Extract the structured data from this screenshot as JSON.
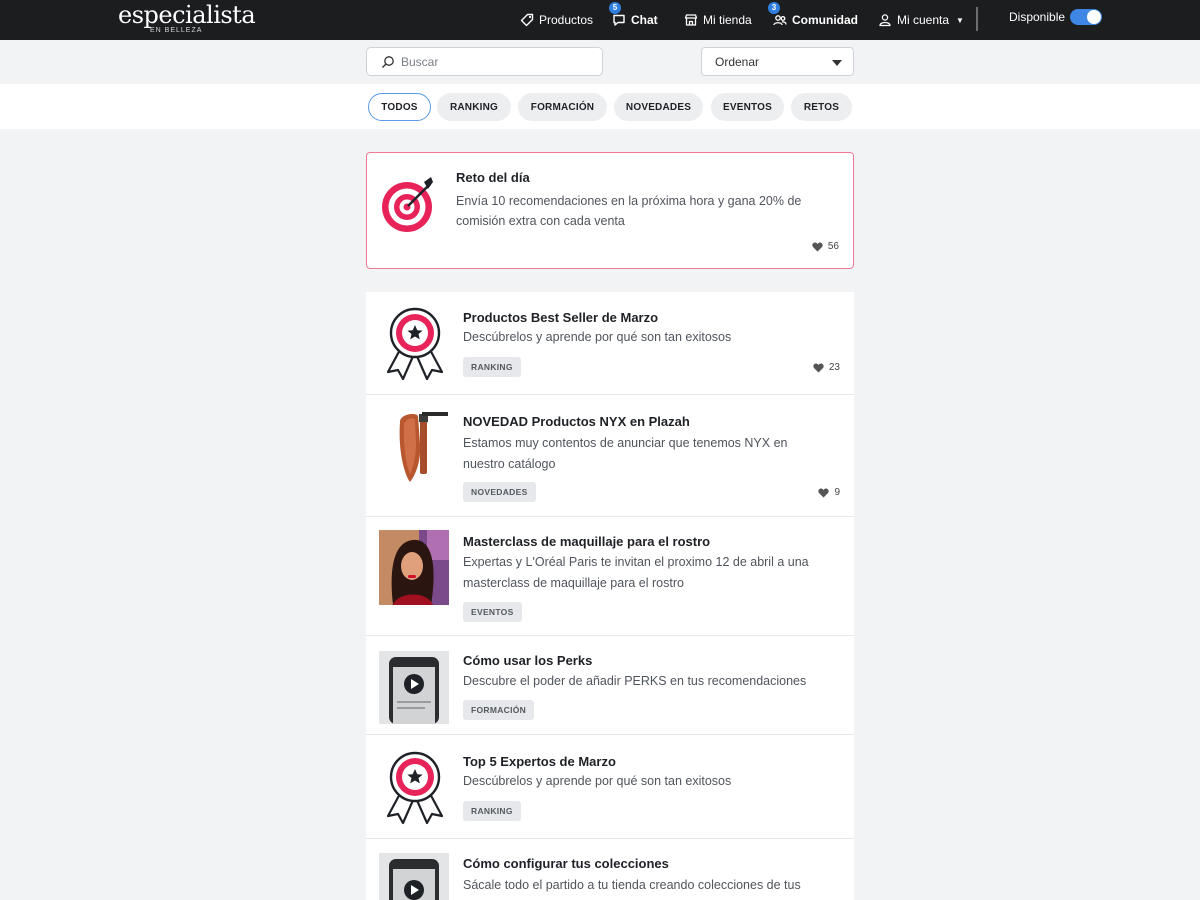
{
  "brand": {
    "name": "especialista",
    "sub": "EN BELLEZA"
  },
  "nav": {
    "productos": "Productos",
    "chat": "Chat",
    "chat_badge": "5",
    "tienda": "Mi tienda",
    "comunidad": "Comunidad",
    "comunidad_badge": "3",
    "cuenta": "Mi cuenta",
    "disponible": "Disponible",
    "disponible_on": true
  },
  "search": {
    "placeholder": "Buscar",
    "icon": "search-icon"
  },
  "order": {
    "label": "Ordenar"
  },
  "filters": [
    "TODOS",
    "RANKING",
    "FORMACIÓN",
    "NOVEDADES",
    "EVENTOS",
    "RETOS"
  ],
  "challenge": {
    "title": "Reto del día",
    "desc_line1": "Envía 10 recomendaciones en la próxima hora y gana 20% de",
    "desc_line2": "comisión extra con cada venta",
    "likes": "56",
    "icon": "target-icon"
  },
  "feed": [
    {
      "title": "Productos Best Seller de Marzo",
      "desc_line1": "Descúbrelos y aprende por qué son tan exitosos",
      "desc_line2": "",
      "tag": "RANKING",
      "likes": "23",
      "thumb": "award-ribbon-icon"
    },
    {
      "title": "NOVEDAD Productos NYX en Plazah",
      "desc_line1": "Estamos muy contentos de anunciar que tenemos NYX en",
      "desc_line2": "nuestro catálogo",
      "tag": "NOVEDADES",
      "likes": "9",
      "thumb": "lipstick-image"
    },
    {
      "title": "Masterclass de maquillaje para el rostro",
      "desc_line1": "Expertas y L'Oréal Paris te invitan el proximo 12 de abril a una",
      "desc_line2": "masterclass de maquillaje para el rostro",
      "tag": "EVENTOS",
      "likes": "",
      "thumb": "portrait-photo"
    },
    {
      "title": "Cómo usar los Perks",
      "desc_line1": "Descubre el poder de añadir PERKS en tus recomendaciones",
      "desc_line2": "",
      "tag": "FORMACIÓN",
      "likes": "",
      "thumb": "video-thumbnail"
    },
    {
      "title": "Top 5 Expertos de Marzo",
      "desc_line1": "Descúbrelos y aprende por qué son tan exitosos",
      "desc_line2": "",
      "tag": "RANKING",
      "likes": "",
      "thumb": "award-ribbon-icon"
    },
    {
      "title": "Cómo configurar tus colecciones",
      "desc_line1": "Sácale todo el partido a tu tienda creando colecciones de tus",
      "desc_line2": "",
      "tag": "",
      "likes": "",
      "thumb": "video-thumbnail"
    }
  ],
  "colors": {
    "navbar": "#1c1d1f",
    "accent_pink": "#e8235a",
    "toggle_blue": "#3f87e5",
    "badge_blue": "#2f7fe0",
    "chip_active_border": "#5b9be8",
    "challenge_border": "#f07a96"
  }
}
